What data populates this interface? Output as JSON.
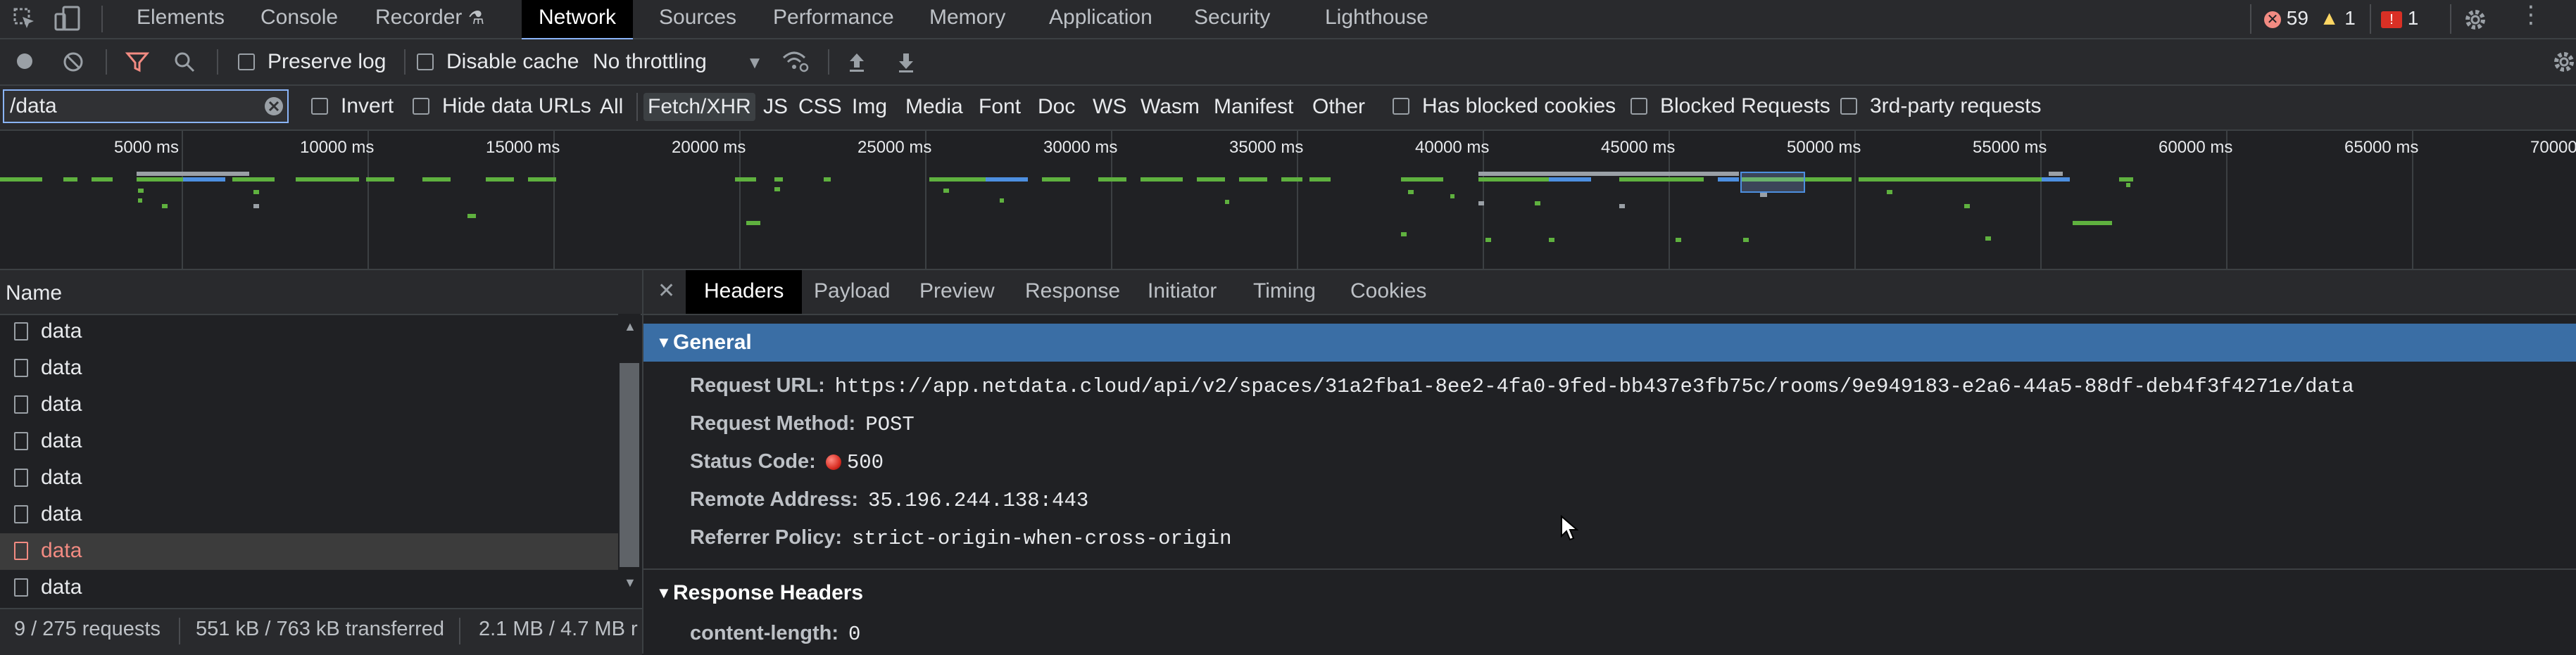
{
  "devtools": {
    "tabs": [
      "Elements",
      "Console",
      "Recorder",
      "Network",
      "Sources",
      "Performance",
      "Memory",
      "Application",
      "Security",
      "Lighthouse"
    ],
    "active_tab": "Network",
    "badges": {
      "errors": "59",
      "warnings": "1",
      "issues": "1"
    }
  },
  "toolbar": {
    "preserve_log": "Preserve log",
    "disable_cache": "Disable cache",
    "throttling": "No throttling"
  },
  "filter": {
    "value": "/data",
    "invert": "Invert",
    "hide_data_urls": "Hide data URLs",
    "types": [
      "All",
      "Fetch/XHR",
      "JS",
      "CSS",
      "Img",
      "Media",
      "Font",
      "Doc",
      "WS",
      "Wasm",
      "Manifest",
      "Other"
    ],
    "active_type": "Fetch/XHR",
    "has_blocked_cookies": "Has blocked cookies",
    "blocked_requests": "Blocked Requests",
    "third_party": "3rd-party requests"
  },
  "timeline": {
    "ticks": [
      "5000 ms",
      "10000 ms",
      "15000 ms",
      "20000 ms",
      "25000 ms",
      "30000 ms",
      "35000 ms",
      "40000 ms",
      "45000 ms",
      "50000 ms",
      "55000 ms",
      "60000 ms",
      "65000 ms",
      "70000 ms"
    ]
  },
  "requests": {
    "header": "Name",
    "rows": [
      {
        "name": "data",
        "status": "ok"
      },
      {
        "name": "data",
        "status": "ok"
      },
      {
        "name": "data",
        "status": "ok"
      },
      {
        "name": "data",
        "status": "ok"
      },
      {
        "name": "data",
        "status": "ok"
      },
      {
        "name": "data",
        "status": "ok"
      },
      {
        "name": "data",
        "status": "error"
      },
      {
        "name": "data",
        "status": "ok"
      }
    ]
  },
  "status_bar": {
    "requests": "9 / 275 requests",
    "transferred": "551 kB / 763 kB transferred",
    "resources": "2.1 MB / 4.7 MB r"
  },
  "details": {
    "tabs": [
      "Headers",
      "Payload",
      "Preview",
      "Response",
      "Initiator",
      "Timing",
      "Cookies"
    ],
    "active_tab": "Headers",
    "general_title": "General",
    "general": [
      {
        "key": "Request URL:",
        "value": "https://app.netdata.cloud/api/v2/spaces/31a2fba1-8ee2-4fa0-9fed-bb437e3fb75c/rooms/9e949183-e2a6-44a5-88df-deb4f3f4271e/data"
      },
      {
        "key": "Request Method:",
        "value": "POST"
      },
      {
        "key": "Status Code:",
        "value": "500"
      },
      {
        "key": "Remote Address:",
        "value": "35.196.244.138:443"
      },
      {
        "key": "Referrer Policy:",
        "value": "strict-origin-when-cross-origin"
      }
    ],
    "response_headers_title": "Response Headers",
    "response_headers": [
      {
        "key": "content-length:",
        "value": "0"
      }
    ]
  },
  "colors": {
    "accent": "#8ab4f8",
    "error": "#f28b82",
    "section_bg": "#3a6ea5",
    "waterfall_green": "#5fb13f",
    "waterfall_blue": "#4d8fe0"
  }
}
